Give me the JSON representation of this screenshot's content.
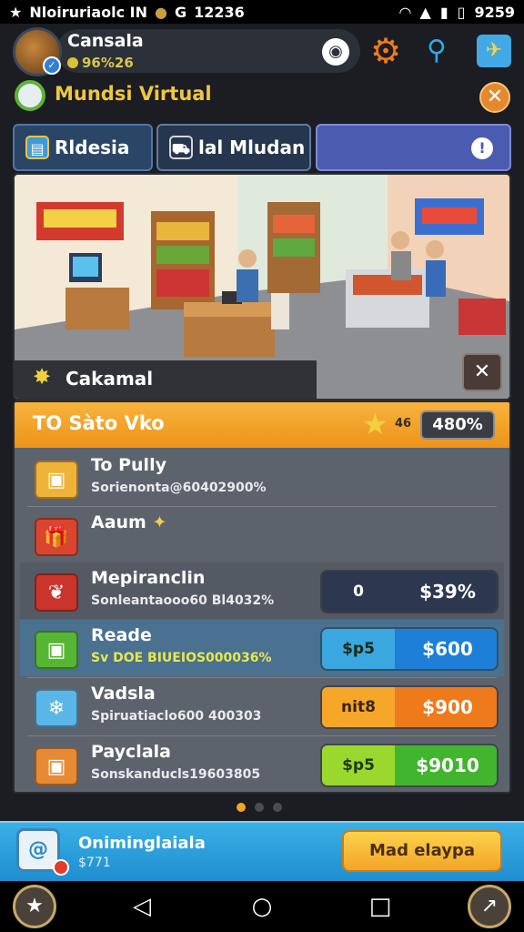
{
  "status_bar": {
    "app_label": "Nloiruriaolc IN",
    "time_left": "12236",
    "time_right": "9259"
  },
  "player": {
    "name": "Cansala",
    "coins": "96%26"
  },
  "title": "Mundsi Virtual",
  "tabs": [
    {
      "label": "Rldesia",
      "icon": "store-icon"
    },
    {
      "label": "lal Mludan",
      "icon": "cart-icon"
    },
    {
      "label": "",
      "icon": "info-icon"
    }
  ],
  "scene": {
    "caption": "Cakamal"
  },
  "panel": {
    "title": "TO Sàto Vko",
    "star_text": "46",
    "percent": "480%",
    "items": [
      {
        "name": "To Pully",
        "sub": "Sorienonta@60402900%",
        "icon": "box-icon"
      },
      {
        "name": "Aaum",
        "sub": "",
        "icon": "gift-bag-icon"
      },
      {
        "name": "Mepiranclin",
        "sub": "Sonleantaooo60 Bl4032%",
        "icon": "produce-crate-icon",
        "price_left": "0",
        "price_right": "$39%"
      },
      {
        "name": "Reade",
        "sub": "Sv DOE BIUEIOS000036%",
        "icon": "green-crate-icon",
        "price_left": "$p5",
        "price_right": "$600"
      },
      {
        "name": "Vadsla",
        "sub": "Spiruatiaclo600 400303",
        "icon": "freezer-box-icon",
        "price_left": "nit8",
        "price_right": "$900"
      },
      {
        "name": "Payclala",
        "sub": "Sonskanducls19603805",
        "icon": "crate-icon",
        "price_left": "$p5",
        "price_right": "$9010"
      }
    ]
  },
  "promo": {
    "title": "Oniminglaiala",
    "sub": "$771",
    "button": "Mad elaypa"
  },
  "colors": {
    "accent": "#f2a526",
    "header": "#ee9319",
    "promo": "#1f8ed0"
  }
}
